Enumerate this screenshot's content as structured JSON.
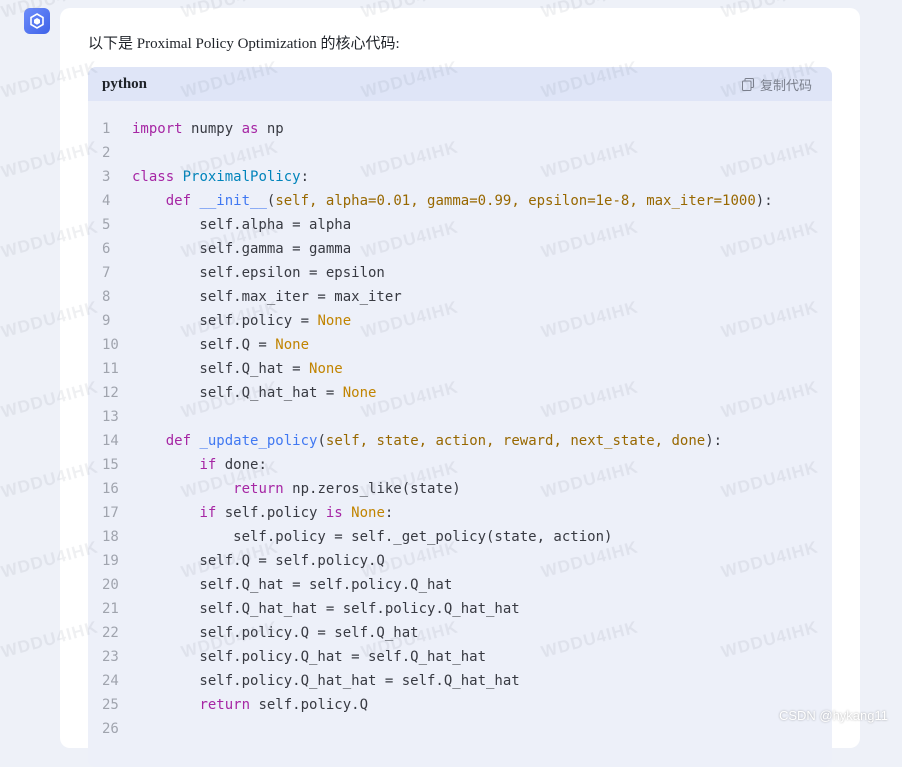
{
  "intro": "以下是 Proximal Policy Optimization 的核心代码:",
  "code": {
    "language": "python",
    "copy_label": "复制代码",
    "lines": [
      {
        "n": "1",
        "tokens": [
          [
            "kw",
            "import"
          ],
          [
            "",
            " numpy "
          ],
          [
            "kw",
            "as"
          ],
          [
            "",
            " np"
          ]
        ]
      },
      {
        "n": "2",
        "tokens": []
      },
      {
        "n": "3",
        "tokens": [
          [
            "kw",
            "class"
          ],
          [
            "",
            " "
          ],
          [
            "cls",
            "ProximalPolicy"
          ],
          [
            "",
            ":"
          ]
        ]
      },
      {
        "n": "4",
        "tokens": [
          [
            "",
            "    "
          ],
          [
            "kw",
            "def"
          ],
          [
            "",
            " "
          ],
          [
            "fn",
            "__init__"
          ],
          [
            "",
            "("
          ],
          [
            "param",
            "self, alpha=0.01, gamma=0.99, epsilon=1e-8, max_iter=1000"
          ],
          [
            "",
            "):"
          ]
        ]
      },
      {
        "n": "5",
        "tokens": [
          [
            "",
            "        self.alpha = alpha"
          ]
        ]
      },
      {
        "n": "6",
        "tokens": [
          [
            "",
            "        self.gamma = gamma"
          ]
        ]
      },
      {
        "n": "7",
        "tokens": [
          [
            "",
            "        self.epsilon = epsilon"
          ]
        ]
      },
      {
        "n": "8",
        "tokens": [
          [
            "",
            "        self.max_iter = max_iter"
          ]
        ]
      },
      {
        "n": "9",
        "tokens": [
          [
            "",
            "        self.policy = "
          ],
          [
            "const",
            "None"
          ]
        ]
      },
      {
        "n": "10",
        "tokens": [
          [
            "",
            "        self.Q = "
          ],
          [
            "const",
            "None"
          ]
        ]
      },
      {
        "n": "11",
        "tokens": [
          [
            "",
            "        self.Q_hat = "
          ],
          [
            "const",
            "None"
          ]
        ]
      },
      {
        "n": "12",
        "tokens": [
          [
            "",
            "        self.Q_hat_hat = "
          ],
          [
            "const",
            "None"
          ]
        ]
      },
      {
        "n": "13",
        "tokens": []
      },
      {
        "n": "14",
        "tokens": [
          [
            "",
            "    "
          ],
          [
            "kw",
            "def"
          ],
          [
            "",
            " "
          ],
          [
            "fn",
            "_update_policy"
          ],
          [
            "",
            "("
          ],
          [
            "param",
            "self, state, action, reward, next_state, done"
          ],
          [
            "",
            "):"
          ]
        ]
      },
      {
        "n": "15",
        "tokens": [
          [
            "",
            "        "
          ],
          [
            "kw",
            "if"
          ],
          [
            "",
            " done:"
          ]
        ]
      },
      {
        "n": "16",
        "tokens": [
          [
            "",
            "            "
          ],
          [
            "kw",
            "return"
          ],
          [
            "",
            " np.zeros_like(state)"
          ]
        ]
      },
      {
        "n": "17",
        "tokens": [
          [
            "",
            "        "
          ],
          [
            "kw",
            "if"
          ],
          [
            "",
            " self.policy "
          ],
          [
            "kw",
            "is"
          ],
          [
            "",
            " "
          ],
          [
            "const",
            "None"
          ],
          [
            "",
            ":"
          ]
        ]
      },
      {
        "n": "18",
        "tokens": [
          [
            "",
            "            self.policy = self._get_policy(state, action)"
          ]
        ]
      },
      {
        "n": "19",
        "tokens": [
          [
            "",
            "        self.Q = self.policy.Q"
          ]
        ]
      },
      {
        "n": "20",
        "tokens": [
          [
            "",
            "        self.Q_hat = self.policy.Q_hat"
          ]
        ]
      },
      {
        "n": "21",
        "tokens": [
          [
            "",
            "        self.Q_hat_hat = self.policy.Q_hat_hat"
          ]
        ]
      },
      {
        "n": "22",
        "tokens": [
          [
            "",
            "        self.policy.Q = self.Q_hat"
          ]
        ]
      },
      {
        "n": "23",
        "tokens": [
          [
            "",
            "        self.policy.Q_hat = self.Q_hat_hat"
          ]
        ]
      },
      {
        "n": "24",
        "tokens": [
          [
            "",
            "        self.policy.Q_hat_hat = self.Q_hat_hat"
          ]
        ]
      },
      {
        "n": "25",
        "tokens": [
          [
            "",
            "        "
          ],
          [
            "kw",
            "return"
          ],
          [
            "",
            " self.policy.Q"
          ]
        ]
      },
      {
        "n": "26",
        "tokens": []
      }
    ]
  },
  "watermark": "WDDU4IHK",
  "footer": "CSDN @hykang11",
  "colors": {
    "accent": "#3f63e8",
    "keyword": "#a626a4",
    "class": "#0184bb",
    "function": "#4078f2",
    "param": "#986801",
    "constant": "#c18401"
  }
}
